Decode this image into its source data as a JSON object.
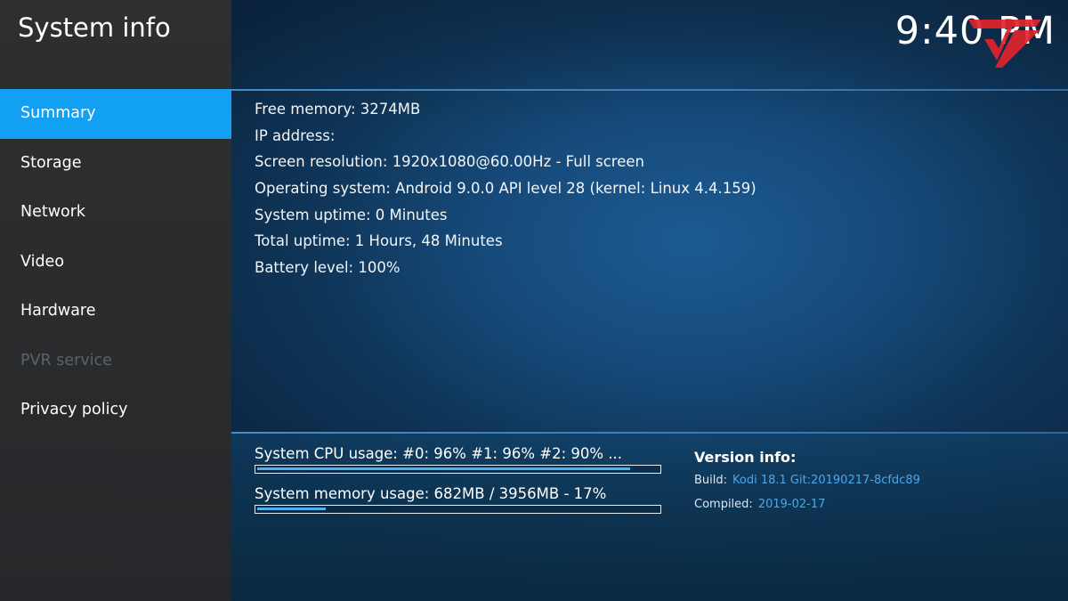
{
  "header": {
    "title": "System info",
    "clock": "9:40 PM"
  },
  "sidebar": {
    "items": [
      {
        "label": "Summary",
        "state": "active"
      },
      {
        "label": "Storage",
        "state": "normal"
      },
      {
        "label": "Network",
        "state": "normal"
      },
      {
        "label": "Video",
        "state": "normal"
      },
      {
        "label": "Hardware",
        "state": "normal"
      },
      {
        "label": "PVR service",
        "state": "disabled"
      },
      {
        "label": "Privacy policy",
        "state": "normal"
      }
    ]
  },
  "summary": {
    "lines": [
      "Free memory: 3274MB",
      "IP address:",
      "Screen resolution: 1920x1080@60.00Hz - Full screen",
      "Operating system: Android 9.0.0 API level 28 (kernel: Linux 4.4.159)",
      "System uptime: 0 Minutes",
      "Total uptime: 1 Hours, 48 Minutes",
      "Battery level: 100%"
    ]
  },
  "usage": {
    "cpu_label": "System CPU usage: #0:  96% #1:  96% #2:  90% ...",
    "cpu_fraction": 0.93,
    "memory_label": "System memory usage: 682MB / 3956MB - 17%",
    "memory_fraction": 0.17
  },
  "version": {
    "title": "Version info:",
    "build_label": "Build:",
    "build_value": "Kodi 18.1 Git:20190217-8cfdc89",
    "compiled_label": "Compiled:",
    "compiled_value": "2019-02-17"
  },
  "colors": {
    "accent": "#12a0f2",
    "link": "#4aa8e8",
    "logo": "#e0242c",
    "disabled": "#5d6168"
  },
  "icons": {
    "logo": "red-v-logo-icon"
  }
}
